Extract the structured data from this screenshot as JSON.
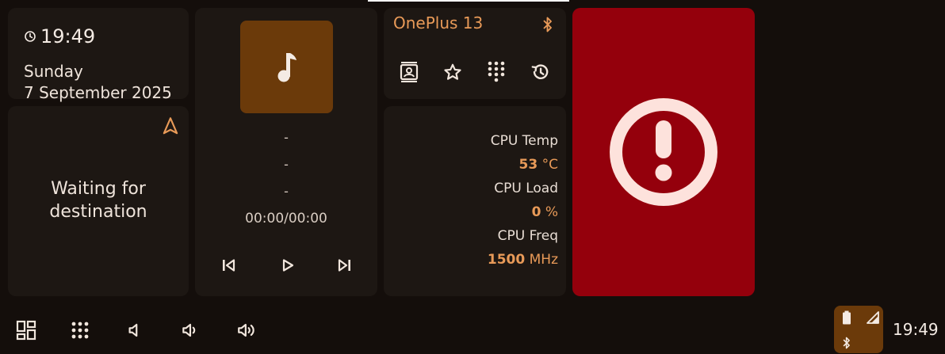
{
  "clock_card": {
    "time": "19:49",
    "day": "Sunday",
    "date": "7 September 2025"
  },
  "navigation": {
    "status_line1": "Waiting for",
    "status_line2": "destination"
  },
  "media": {
    "title": "-",
    "artist": "-",
    "album": "-",
    "progress": "00:00/00:00"
  },
  "phone": {
    "device_name": "OnePlus 13"
  },
  "cpu": {
    "temp_label": "CPU Temp",
    "temp_value": "53",
    "temp_unit": "°C",
    "load_label": "CPU Load",
    "load_value": "0",
    "load_unit": "%",
    "freq_label": "CPU Freq",
    "freq_value": "1500",
    "freq_unit": "MHz"
  },
  "statusbar": {
    "time": "19:49"
  },
  "colors": {
    "accent": "#e89a58",
    "alert_bg": "#94000c",
    "card_bg": "#1d1713",
    "brown": "#6b3a0a"
  }
}
